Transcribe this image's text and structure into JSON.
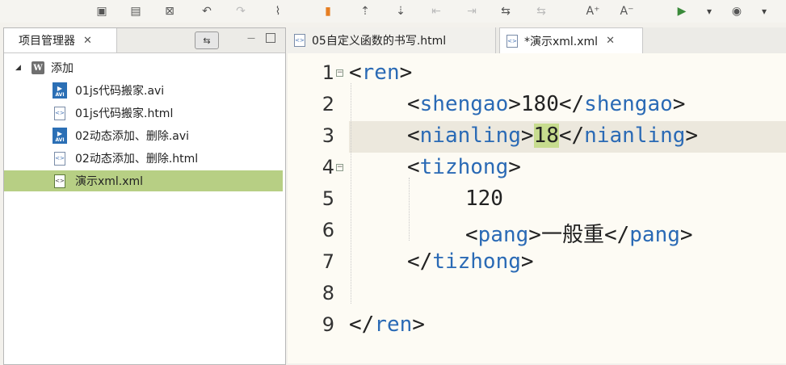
{
  "toolbar": {
    "buttons": [
      {
        "name": "save-icon",
        "glyph": "▣"
      },
      {
        "name": "save-all-icon",
        "glyph": "▤"
      },
      {
        "name": "delete-icon",
        "glyph": "⊠"
      },
      {
        "name": "undo-icon",
        "glyph": "↶"
      },
      {
        "name": "redo-icon",
        "glyph": "↷"
      },
      {
        "name": "format-icon",
        "glyph": "⌇"
      },
      {
        "name": "bookmark-icon",
        "glyph": "▮"
      },
      {
        "name": "move-up-icon",
        "glyph": "⇡"
      },
      {
        "name": "move-down-icon",
        "glyph": "⇣"
      },
      {
        "name": "indent-left-icon",
        "glyph": "⇤"
      },
      {
        "name": "indent-right-icon",
        "glyph": "⇥"
      },
      {
        "name": "comment-icon",
        "glyph": "⇆"
      },
      {
        "name": "uncomment-icon",
        "glyph": "⇆"
      },
      {
        "name": "font-increase-icon",
        "glyph": "A⁺"
      },
      {
        "name": "font-decrease-icon",
        "glyph": "A⁻"
      },
      {
        "name": "run-icon",
        "glyph": "▶"
      },
      {
        "name": "run-dropdown-icon",
        "glyph": "▾"
      },
      {
        "name": "browser-icon",
        "glyph": "◉"
      },
      {
        "name": "browser-dropdown-icon",
        "glyph": "▾"
      }
    ]
  },
  "project_panel": {
    "tab_title": "项目管理器",
    "close": "✕",
    "link_glyph": "⇆",
    "minimize_glyph": "—",
    "project": {
      "name": "添加",
      "icon": "W"
    },
    "files": [
      {
        "name": "01js代码搬家.avi",
        "type": "avi"
      },
      {
        "name": "01js代码搬家.html",
        "type": "html"
      },
      {
        "name": "02动态添加、删除.avi",
        "type": "avi"
      },
      {
        "name": "02动态添加、删除.html",
        "type": "html"
      },
      {
        "name": "演示xml.xml",
        "type": "xml",
        "selected": true
      }
    ]
  },
  "editor": {
    "tabs": [
      {
        "label": "05自定义函数的书写.html",
        "icon": "<>",
        "active": false
      },
      {
        "label": "*演示xml.xml",
        "icon": "<>",
        "active": true,
        "close": "✕"
      }
    ],
    "lines": [
      {
        "n": "1",
        "fold": true,
        "indent": 0,
        "parts": [
          [
            "bk",
            "<"
          ],
          [
            "tag",
            "ren"
          ],
          [
            "bk",
            ">"
          ]
        ]
      },
      {
        "n": "2",
        "indent": 1,
        "parts": [
          [
            "bk",
            "<"
          ],
          [
            "tag",
            "shengao"
          ],
          [
            "bk",
            ">"
          ],
          [
            "txt",
            "180"
          ],
          [
            "bk",
            "</"
          ],
          [
            "tag",
            "shengao"
          ],
          [
            "bk",
            ">"
          ]
        ]
      },
      {
        "n": "3",
        "indent": 1,
        "current": true,
        "parts": [
          [
            "bk",
            "<"
          ],
          [
            "tag",
            "nianling"
          ],
          [
            "bk",
            ">"
          ],
          [
            "hl",
            "18"
          ],
          [
            "bk",
            "</"
          ],
          [
            "tag",
            "nianling"
          ],
          [
            "bk",
            ">"
          ]
        ]
      },
      {
        "n": "4",
        "fold": true,
        "indent": 1,
        "parts": [
          [
            "bk",
            "<"
          ],
          [
            "tag",
            "tizhong"
          ],
          [
            "bk",
            ">"
          ]
        ]
      },
      {
        "n": "5",
        "indent": 2,
        "parts": [
          [
            "txt",
            "120"
          ]
        ]
      },
      {
        "n": "6",
        "indent": 2,
        "parts": [
          [
            "bk",
            "<"
          ],
          [
            "tag",
            "pang"
          ],
          [
            "bk",
            ">"
          ],
          [
            "txt",
            "一般重"
          ],
          [
            "bk",
            "</"
          ],
          [
            "tag",
            "pang"
          ],
          [
            "bk",
            ">"
          ]
        ]
      },
      {
        "n": "7",
        "indent": 1,
        "parts": [
          [
            "bk",
            "</"
          ],
          [
            "tag",
            "tizhong"
          ],
          [
            "bk",
            ">"
          ]
        ]
      },
      {
        "n": "8",
        "indent": 0,
        "parts": []
      },
      {
        "n": "9",
        "indent": 0,
        "parts": [
          [
            "bk",
            "</"
          ],
          [
            "tag",
            "ren"
          ],
          [
            "bk",
            ">"
          ]
        ]
      }
    ]
  }
}
